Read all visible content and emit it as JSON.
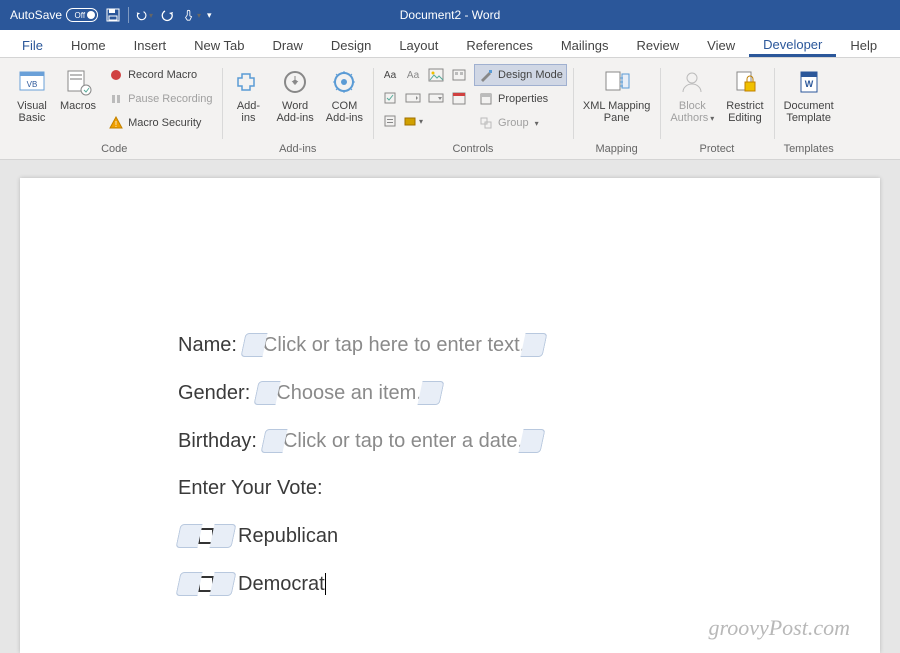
{
  "titlebar": {
    "autosave_label": "AutoSave",
    "autosave_state": "Off",
    "document_title": "Document2 - Word"
  },
  "tabs": {
    "file": "File",
    "home": "Home",
    "insert": "Insert",
    "newtab": "New Tab",
    "draw": "Draw",
    "design": "Design",
    "layout": "Layout",
    "references": "References",
    "mailings": "Mailings",
    "review": "Review",
    "view": "View",
    "developer": "Developer",
    "help": "Help"
  },
  "ribbon": {
    "code": {
      "visual_basic": "Visual\nBasic",
      "macros": "Macros",
      "record_macro": "Record Macro",
      "pause_recording": "Pause Recording",
      "macro_security": "Macro Security",
      "group_label": "Code"
    },
    "addins": {
      "addins": "Add-\nins",
      "word_addins": "Word\nAdd-ins",
      "com_addins": "COM\nAdd-ins",
      "group_label": "Add-ins"
    },
    "controls": {
      "design_mode": "Design Mode",
      "properties": "Properties",
      "group_btn": "Group",
      "group_label": "Controls"
    },
    "mapping": {
      "xml_mapping": "XML Mapping\nPane",
      "group_label": "Mapping"
    },
    "protect": {
      "block_authors": "Block\nAuthors",
      "restrict_editing": "Restrict\nEditing",
      "group_label": "Protect"
    },
    "templates": {
      "document_template": "Document\nTemplate",
      "group_label": "Templates"
    }
  },
  "document": {
    "name_label": "Name:",
    "name_placeholder": "Click or tap here to enter text.",
    "gender_label": "Gender:",
    "gender_placeholder": "Choose an item.",
    "birthday_label": "Birthday:",
    "birthday_placeholder": "Click or tap to enter a date.",
    "vote_heading": "Enter Your Vote:",
    "option1": "Republican",
    "option2": "Democrat"
  },
  "watermark": "groovyPost.com"
}
